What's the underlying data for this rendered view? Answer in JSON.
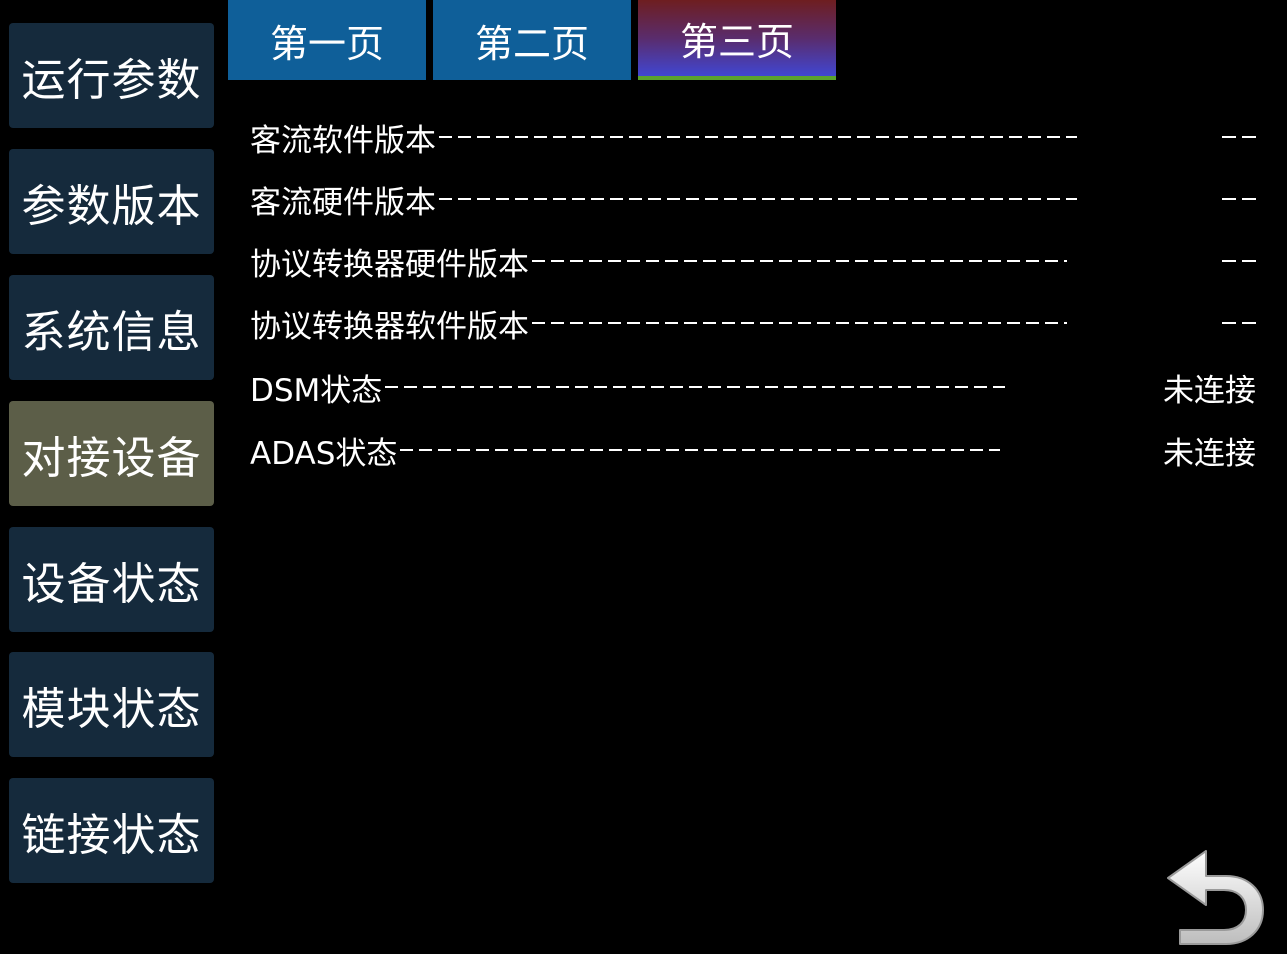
{
  "sidebar": {
    "items": [
      {
        "label": "运行参数"
      },
      {
        "label": "参数版本"
      },
      {
        "label": "系统信息"
      },
      {
        "label": "对接设备"
      },
      {
        "label": "设备状态"
      },
      {
        "label": "模块状态"
      },
      {
        "label": "链接状态"
      }
    ],
    "active_index": 3
  },
  "tabs": [
    {
      "label": "第一页"
    },
    {
      "label": "第二页"
    },
    {
      "label": "第三页"
    }
  ],
  "active_tab_index": 2,
  "rows": [
    {
      "label": "客流软件版本",
      "value": "--"
    },
    {
      "label": "客流硬件版本",
      "value": "--"
    },
    {
      "label": "协议转换器硬件版本",
      "value": "--"
    },
    {
      "label": "协议转换器软件版本",
      "value": "--"
    },
    {
      "label": "DSM状态",
      "value": "未连接"
    },
    {
      "label": "ADAS状态",
      "value": "未连接"
    }
  ],
  "back_button": {
    "icon": "back-arrow-icon"
  },
  "colors": {
    "background": "#000000",
    "sidebar_item": "#152a3c",
    "sidebar_item_active": "#5c5e48",
    "tab": "#0f5f99",
    "tab_active_top": "#6e1e20",
    "tab_active_bottom": "#4146d2",
    "tab_active_underline": "#5aa22e",
    "text": "#ffffff"
  }
}
